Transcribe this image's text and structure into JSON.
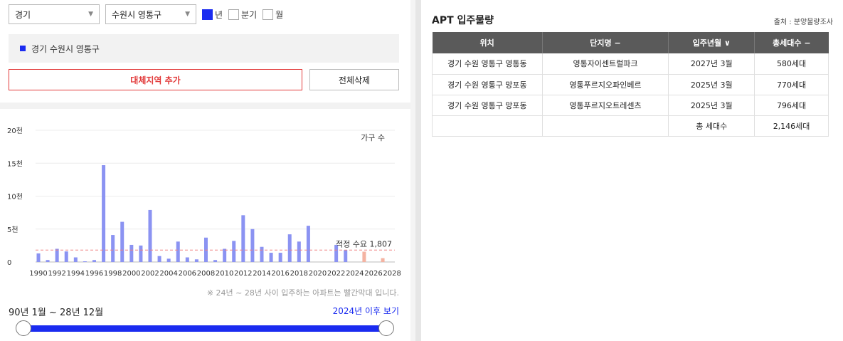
{
  "filters": {
    "province": "경기",
    "district": "수원시 영통구",
    "periods": [
      {
        "label": "년",
        "checked": true
      },
      {
        "label": "분기",
        "checked": false
      },
      {
        "label": "월",
        "checked": false
      }
    ]
  },
  "region_tag": "경기 수원시 영통구",
  "buttons": {
    "add_region": "대체지역 추가",
    "delete_all": "전체삭제"
  },
  "chart_note": "※ 24년 ~ 28년 사이 입주하는 아파트는 빨간막대 입니다.",
  "range": {
    "label": "90년 1월 ~ 28년 12월",
    "link": "2024년 이후 보기"
  },
  "colors": {
    "accent": "#1a2bf0",
    "bar": "#8b93f2",
    "bar_future": "#f4b3a2",
    "demand_line": "#f08080",
    "add_button": "#e23b3b"
  },
  "chart_data": {
    "type": "bar",
    "title": "",
    "legend": "가구 수",
    "xlabel": "",
    "ylabel": "",
    "ylim": [
      0,
      20000
    ],
    "y_ticks": [
      {
        "value": 0,
        "label": "0"
      },
      {
        "value": 5000,
        "label": "5천"
      },
      {
        "value": 10000,
        "label": "10천"
      },
      {
        "value": 15000,
        "label": "15천"
      },
      {
        "value": 20000,
        "label": "20천"
      }
    ],
    "x_tick_labels": [
      "1990",
      "1992",
      "1994",
      "1996",
      "1998",
      "2000",
      "2002",
      "2004",
      "2006",
      "2008",
      "2010",
      "2012",
      "2014",
      "2016",
      "2018",
      "2020",
      "2022",
      "2024",
      "2026",
      "2028"
    ],
    "categories": [
      1990,
      1991,
      1992,
      1993,
      1994,
      1995,
      1996,
      1997,
      1998,
      1999,
      2000,
      2001,
      2002,
      2003,
      2004,
      2005,
      2006,
      2007,
      2008,
      2009,
      2010,
      2011,
      2012,
      2013,
      2014,
      2015,
      2016,
      2017,
      2018,
      2019,
      2020,
      2021,
      2022,
      2023,
      2024,
      2025,
      2026,
      2027,
      2028
    ],
    "values": [
      1300,
      300,
      2000,
      1600,
      700,
      100,
      300,
      14700,
      4100,
      6100,
      2600,
      2500,
      7900,
      900,
      500,
      3100,
      700,
      400,
      3700,
      300,
      2000,
      3200,
      7100,
      5000,
      2300,
      1400,
      1400,
      4200,
      3100,
      5500,
      0,
      0,
      2600,
      1800,
      0,
      1566,
      0,
      580,
      0
    ],
    "future_from": 2024,
    "demand": {
      "value": 1807,
      "label": "적정 수요 1,807"
    }
  },
  "supply": {
    "title": "APT 입주물량",
    "source": "출처 : 분양물량조사",
    "headers": [
      "위치",
      "단지명 −",
      "입주년월 ∨",
      "총세대수 −"
    ],
    "rows": [
      [
        "경기 수원 영통구 영통동",
        "영통자이센트럴파크",
        "2027년 3월",
        "580세대"
      ],
      [
        "경기 수원 영통구 망포동",
        "영통푸르지오파인베르",
        "2025년 3월",
        "770세대"
      ],
      [
        "경기 수원 영통구 망포동",
        "영통푸르지오트레센츠",
        "2025년 3월",
        "796세대"
      ]
    ],
    "total_label": "총 세대수",
    "total_value": "2,146세대"
  }
}
